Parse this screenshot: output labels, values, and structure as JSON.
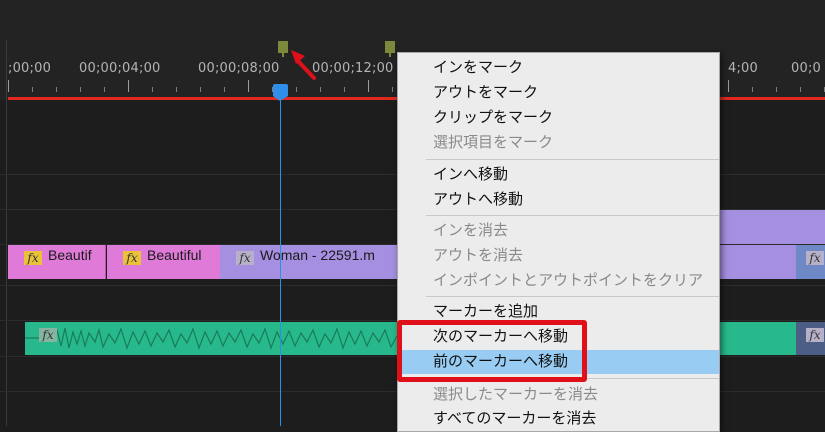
{
  "timeline": {
    "ruler_ticks": [
      ";00;00",
      "00;00;04;00",
      "00;00;08;00",
      "00;00;12;00",
      "4;00",
      "00;0"
    ],
    "clips": {
      "video": [
        {
          "name": "Beautif",
          "color": "#e07ad8"
        },
        {
          "name": "Beautiful",
          "color": "#e07ad8"
        },
        {
          "name": "Woman - 22591.m",
          "color": "#a48fe0"
        }
      ],
      "audio_color": "#27b98b"
    },
    "fx_label": "fx",
    "colors": {
      "playhead": "#2f8fe8",
      "work_area": "#e0291f",
      "marker": "#7b8a3a"
    }
  },
  "context_menu": {
    "items": [
      {
        "label": "インをマーク",
        "enabled": true
      },
      {
        "label": "アウトをマーク",
        "enabled": true
      },
      {
        "label": "クリップをマーク",
        "enabled": true
      },
      {
        "label": "選択項目をマーク",
        "enabled": false
      },
      {
        "label": "インへ移動",
        "enabled": true
      },
      {
        "label": "アウトへ移動",
        "enabled": true
      },
      {
        "label": "インを消去",
        "enabled": false
      },
      {
        "label": "アウトを消去",
        "enabled": false
      },
      {
        "label": "インポイントとアウトポイントをクリア",
        "enabled": false
      },
      {
        "label": "マーカーを追加",
        "enabled": true
      },
      {
        "label": "次のマーカーへ移動",
        "enabled": true
      },
      {
        "label": "前のマーカーへ移動",
        "enabled": true,
        "highlighted": true
      },
      {
        "label": "選択したマーカーを消去",
        "enabled": false
      },
      {
        "label": "すべてのマーカーを消去",
        "enabled": true
      }
    ]
  },
  "annotation": {
    "color": "#e0101a"
  }
}
